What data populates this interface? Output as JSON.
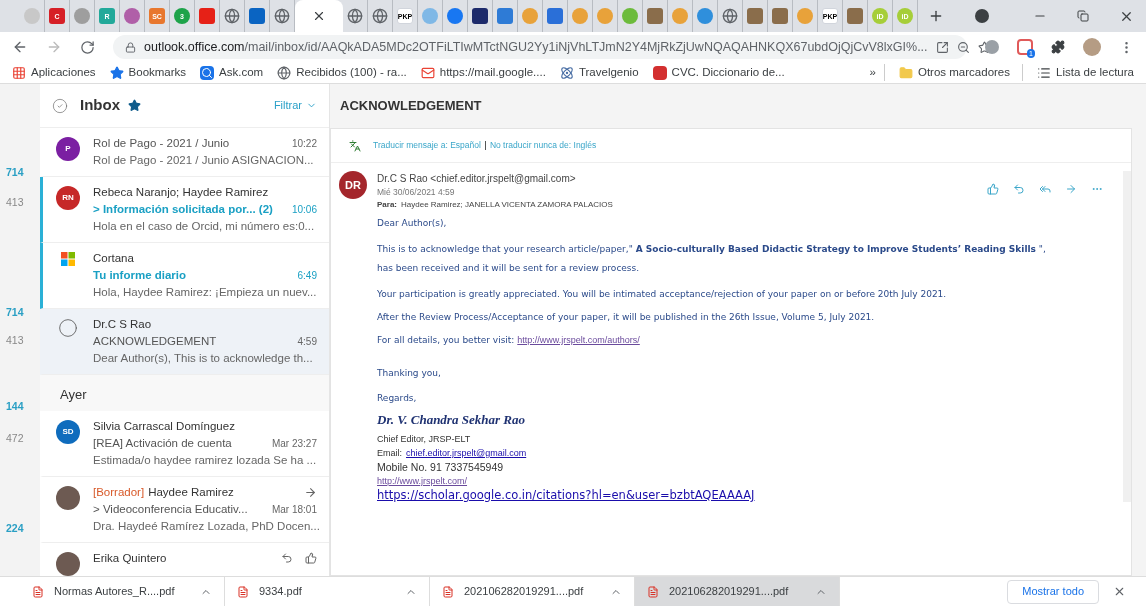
{
  "tabs": [
    {
      "kind": "circle",
      "color": "#c8c8c8",
      "selected": false
    },
    {
      "kind": "square",
      "color": "#d61f26",
      "label": "C",
      "selected": false
    },
    {
      "kind": "circle",
      "color": "#9e9e9e",
      "selected": false
    },
    {
      "kind": "square",
      "color": "#22a99a",
      "label": "R",
      "selected": false
    },
    {
      "kind": "circle",
      "color": "#b05fa8",
      "selected": false
    },
    {
      "kind": "square",
      "color": "#e8772e",
      "label": "SC",
      "selected": false
    },
    {
      "kind": "circle",
      "color": "#1ea34a",
      "label": "3",
      "selected": false
    },
    {
      "kind": "square",
      "color": "#e62117",
      "selected": false
    },
    {
      "kind": "globe",
      "color": "#5f6368",
      "selected": false
    },
    {
      "kind": "square",
      "color": "#0a64c2",
      "selected": false
    },
    {
      "kind": "globe",
      "color": "#5f6368",
      "selected": false
    },
    {
      "kind": "close",
      "color": "#3c4043",
      "selected": true
    },
    {
      "kind": "globe",
      "color": "#5f6368",
      "selected": false
    },
    {
      "kind": "globe",
      "color": "#5f6368",
      "selected": false
    },
    {
      "kind": "square",
      "color": "#ffffff",
      "label": "PKP",
      "selected": false
    },
    {
      "kind": "circle",
      "color": "#7fb8e6",
      "selected": false
    },
    {
      "kind": "circle",
      "color": "#1877f2",
      "selected": false
    },
    {
      "kind": "square",
      "color": "#1d2a6b",
      "selected": false
    },
    {
      "kind": "square",
      "color": "#2e7bd6",
      "selected": false
    },
    {
      "kind": "circle",
      "color": "#e8a23a",
      "selected": false
    },
    {
      "kind": "square",
      "color": "#2a6fd8",
      "selected": false
    },
    {
      "kind": "circle",
      "color": "#e8a23a",
      "selected": false
    },
    {
      "kind": "circle",
      "color": "#e8a23a",
      "selected": false
    },
    {
      "kind": "circle",
      "color": "#6cbb3c",
      "selected": false
    },
    {
      "kind": "square",
      "color": "#8a6d4b",
      "selected": false
    },
    {
      "kind": "circle",
      "color": "#e8a23a",
      "selected": false
    },
    {
      "kind": "circle",
      "color": "#2f8fdc",
      "selected": false
    },
    {
      "kind": "globe",
      "color": "#5f6368",
      "selected": false
    },
    {
      "kind": "square",
      "color": "#8a6d4b",
      "selected": false
    },
    {
      "kind": "square",
      "color": "#8a6d4b",
      "selected": false
    },
    {
      "kind": "circle",
      "color": "#e8a23a",
      "selected": false
    },
    {
      "kind": "square",
      "color": "#ffffff",
      "label": "PKP",
      "selected": false
    },
    {
      "kind": "square",
      "color": "#8a6d4b",
      "selected": false
    },
    {
      "kind": "circle",
      "color": "#a6ce39",
      "label": "iD",
      "selected": false
    },
    {
      "kind": "circle",
      "color": "#a6ce39",
      "label": "iD",
      "selected": false
    }
  ],
  "address": {
    "domain": "outlook.office.com",
    "path": "/mail/inbox/id/AAQkADA5MDc2OTFiLTIwMTctNGU2Yy1iNjVhLTJmN2Y4MjRkZjUwNQAQAHNKQX67ubdOjQjCvV8lxGI%..."
  },
  "extension_badge": "1",
  "bookmarks": [
    {
      "kind": "apps",
      "label": "Aplicaciones"
    },
    {
      "kind": "star",
      "label": "Bookmarks"
    },
    {
      "kind": "search",
      "label": "Ask.com"
    },
    {
      "kind": "globe",
      "label": "Recibidos (100) - ra..."
    },
    {
      "kind": "mail",
      "label": "https://mail.google...."
    },
    {
      "kind": "atom",
      "label": "Travelgenio"
    },
    {
      "kind": "cvc",
      "label": "CVC. Diccionario de..."
    }
  ],
  "bookmarks_more": "»",
  "other_bookmarks": "Otros marcadores",
  "reading_list": "Lista de lectura",
  "side_counts": [
    {
      "text": "714",
      "unread": true
    },
    {
      "text": "413",
      "unread": false
    },
    {
      "text": "714",
      "unread": true
    },
    {
      "text": "413",
      "unread": false
    },
    {
      "text": "144",
      "unread": true
    },
    {
      "text": "472",
      "unread": false
    },
    {
      "text": "224",
      "unread": true
    }
  ],
  "folder": {
    "title": "Inbox",
    "filter": "Filtrar"
  },
  "messages": [
    {
      "kind": "letters",
      "avatar": "P",
      "color": "#7b1fa2",
      "subject": "Rol de Pago - 2021 / Junio",
      "time": "10:22",
      "preview": "Rol de Pago - 2021 / Junio ASIGNACION...",
      "unread": false,
      "selected": false
    },
    {
      "kind": "letters",
      "avatar": "RN",
      "color": "#c62828",
      "sender": "Rebeca Naranjo; Haydee Ramirez",
      "subject": "> Información solicitada por...  (2)",
      "time": "10:06",
      "preview": "Hola en el caso de Orcid, mi número es:0...",
      "unread": true,
      "selected": false
    },
    {
      "kind": "logo",
      "sender": "Cortana",
      "subject": "Tu informe diario",
      "time": "6:49",
      "preview": "Hola, Haydee Ramirez: ¡Empieza un nuev...",
      "unread": true,
      "selected": false
    },
    {
      "kind": "radio",
      "sender": "Dr.C S Rao",
      "subject": "ACKNOWLEDGEMENT",
      "time": "4:59",
      "preview": "Dear Author(s), This is to acknowledge th...",
      "unread": false,
      "selected": true
    },
    {
      "kind": "group",
      "label": "Ayer"
    },
    {
      "kind": "letters",
      "avatar": "SD",
      "color": "#0f6cbd",
      "sender": "Silvia Carrascal Domínguez",
      "subject": "[REA] Activación de cuenta",
      "time": "Mar 23:27",
      "preview": "Estimada/o haydee ramirez lozada Se ha ...",
      "unread": false,
      "selected": false
    },
    {
      "kind": "photo",
      "draft": "[Borrador]",
      "sender": "Haydee Ramirez",
      "subject": "> Videoconferencia Educativ...",
      "time": "Mar 18:01",
      "preview": "Dra. Haydeé Ramírez Lozada, PhD Docen...",
      "unread": false,
      "selected": false
    },
    {
      "kind": "photo",
      "sender": "Erika Quintero",
      "unread": false,
      "selected": false
    }
  ],
  "reading": {
    "title": "ACKNOWLEDGEMENT",
    "translate": "Traducir mensaje a: Español",
    "never_translate": "No traducir nunca de: Inglés",
    "avatar": "DR",
    "from": "Dr.C S Rao <chief.editor.jrspelt@gmail.com>",
    "date": "Mié 30/06/2021 4:59",
    "to_label": "Para:",
    "to": "Haydee Ramirez; JANELLA VICENTA ZAMORA PALACIOS",
    "paragraphs": [
      "Dear Author(s),",
      "This is to acknowledge that your research article/paper,\" **A Socio-culturally Based Didactic Strategy to Improve Students’ Reading Skills** \", has been received and it will be sent for a review process.",
      "Your participation is greatly appreciated.  You will be intimated acceptance/rejection of your paper on or before 20th July 2021.",
      "After the Review Process/Acceptance of your paper, it will be published in the 26th Issue, Volume 5, July 2021."
    ],
    "visit_text": "For all details, you better visit:",
    "visit_link": "http://www.jrspelt.com/authors/",
    "closing": [
      "Thanking you,",
      "Regards,"
    ],
    "signature": "Dr. V. Chandra Sekhar Rao",
    "role": "Chief Editor, JRSP-ELT",
    "email_label": "Email:",
    "email": "chief.editor.jrspelt@gmail.com",
    "mobile": "Mobile No. 91 7337545949",
    "site": "http://www.jrspelt.com/",
    "scholar": "https://scholar.google.co.in/citations?hl=en&user=bzbtAQEAAAAJ"
  },
  "downloads": [
    {
      "name": "Normas Autores_R....pdf",
      "selected": false
    },
    {
      "name": "9334.pdf",
      "selected": false
    },
    {
      "name": "202106282019291....pdf",
      "selected": false
    },
    {
      "name": "202106282019291....pdf",
      "selected": true
    }
  ],
  "show_all": "Mostrar todo"
}
